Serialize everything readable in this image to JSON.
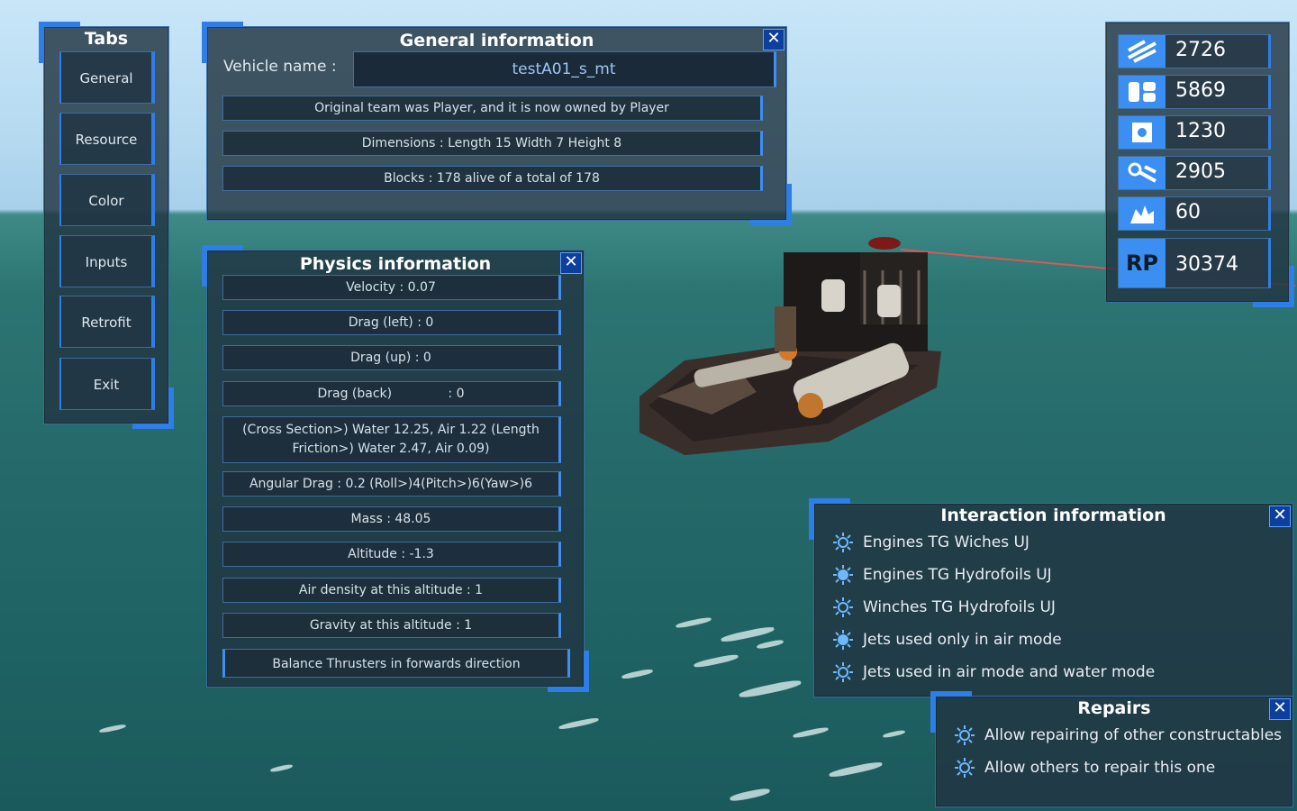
{
  "tabs": {
    "title": "Tabs",
    "items": [
      "General",
      "Resource",
      "Color",
      "Inputs",
      "Retrofit",
      "Exit"
    ]
  },
  "general": {
    "title": "General information",
    "close": "✕",
    "vehicle_label": "Vehicle name :",
    "vehicle_value": "testA01_s_mt",
    "team": "Original team was Player, and it is now owned by Player",
    "dimensions": "Dimensions : Length 15 Width 7 Height 8",
    "blocks": "Blocks : 178 alive of a total of 178"
  },
  "physics": {
    "title": "Physics information",
    "close": "✕",
    "rows": [
      "Velocity : 0.07",
      "Drag (left) : 0",
      "Drag (up)  : 0",
      "Drag (back)              : 0",
      "(Cross Section>) Water 12.25, Air 1.22      (Length Friction>) Water 2.47, Air 0.09)",
      "Angular Drag : 0.2 (Roll>)4(Pitch>)6(Yaw>)6",
      "Mass : 48.05",
      "Altitude : -1.3",
      "Air density at this altitude : 1",
      "Gravity at this altitude : 1",
      "Balance Thrusters in forwards direction"
    ]
  },
  "resources": {
    "items": [
      {
        "icon": "fuel-icon",
        "value": "2726"
      },
      {
        "icon": "material-icon",
        "value": "5869"
      },
      {
        "icon": "ammo-icon",
        "value": "1230"
      },
      {
        "icon": "engine-icon",
        "value": "2905"
      },
      {
        "icon": "crystal-icon",
        "value": "60"
      },
      {
        "icon": "rp-icon",
        "label": "RP",
        "value": "30374"
      }
    ],
    "accent": "#3b8ff2"
  },
  "interaction": {
    "title": "Interaction information",
    "close": "✕",
    "items": [
      "Engines TG Wiches UJ",
      "Engines TG Hydrofoils UJ",
      "Winches TG Hydrofoils UJ",
      "Jets used only in air mode",
      "Jets used in air mode and water mode"
    ]
  },
  "repairs": {
    "title": "Repairs",
    "close": "✕",
    "items": [
      "Allow repairing of other constructables",
      "Allow others to repair this one"
    ]
  }
}
